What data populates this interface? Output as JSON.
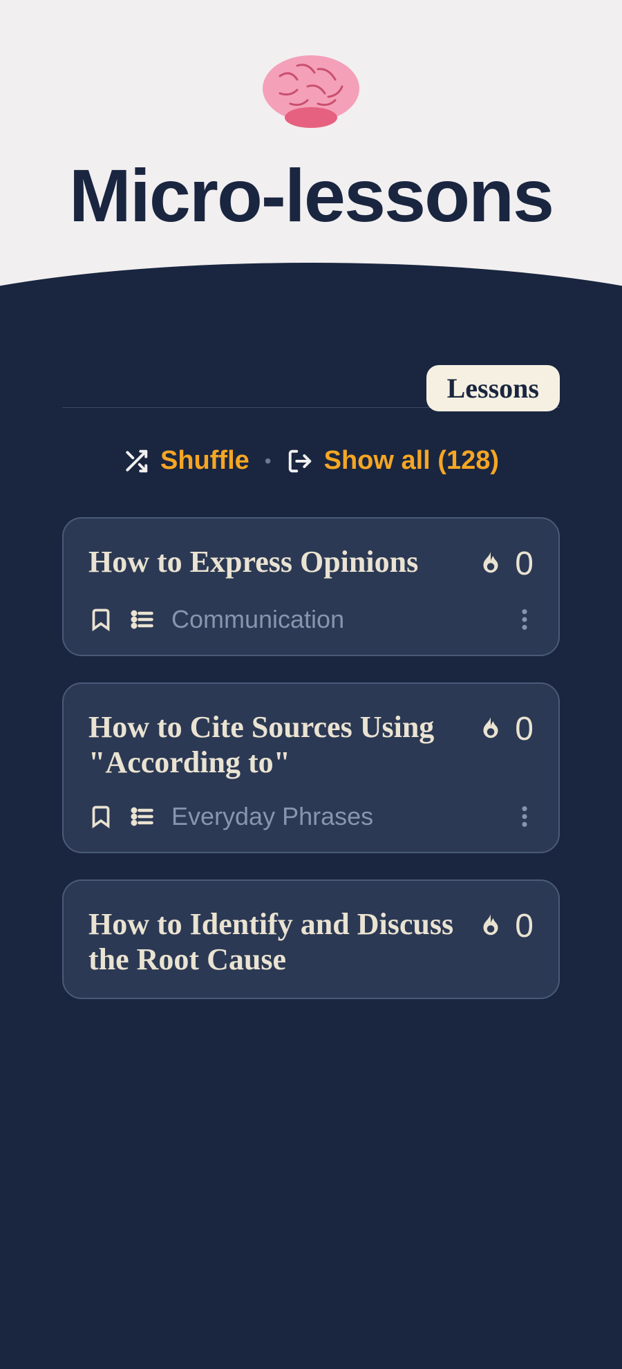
{
  "hero": {
    "title": "Micro-lessons"
  },
  "tabs": {
    "active": "Lessons"
  },
  "actions": {
    "shuffle_label": "Shuffle",
    "showall_label": "Show all (128)"
  },
  "lessons": [
    {
      "title": "How to Express Opinions",
      "category": "Communication",
      "streak": "0"
    },
    {
      "title": "How to Cite Sources Using \"According to\"",
      "category": "Everyday Phrases",
      "streak": "0"
    },
    {
      "title": "How to Identify and Discuss the Root Cause",
      "category": "",
      "streak": "0"
    }
  ]
}
